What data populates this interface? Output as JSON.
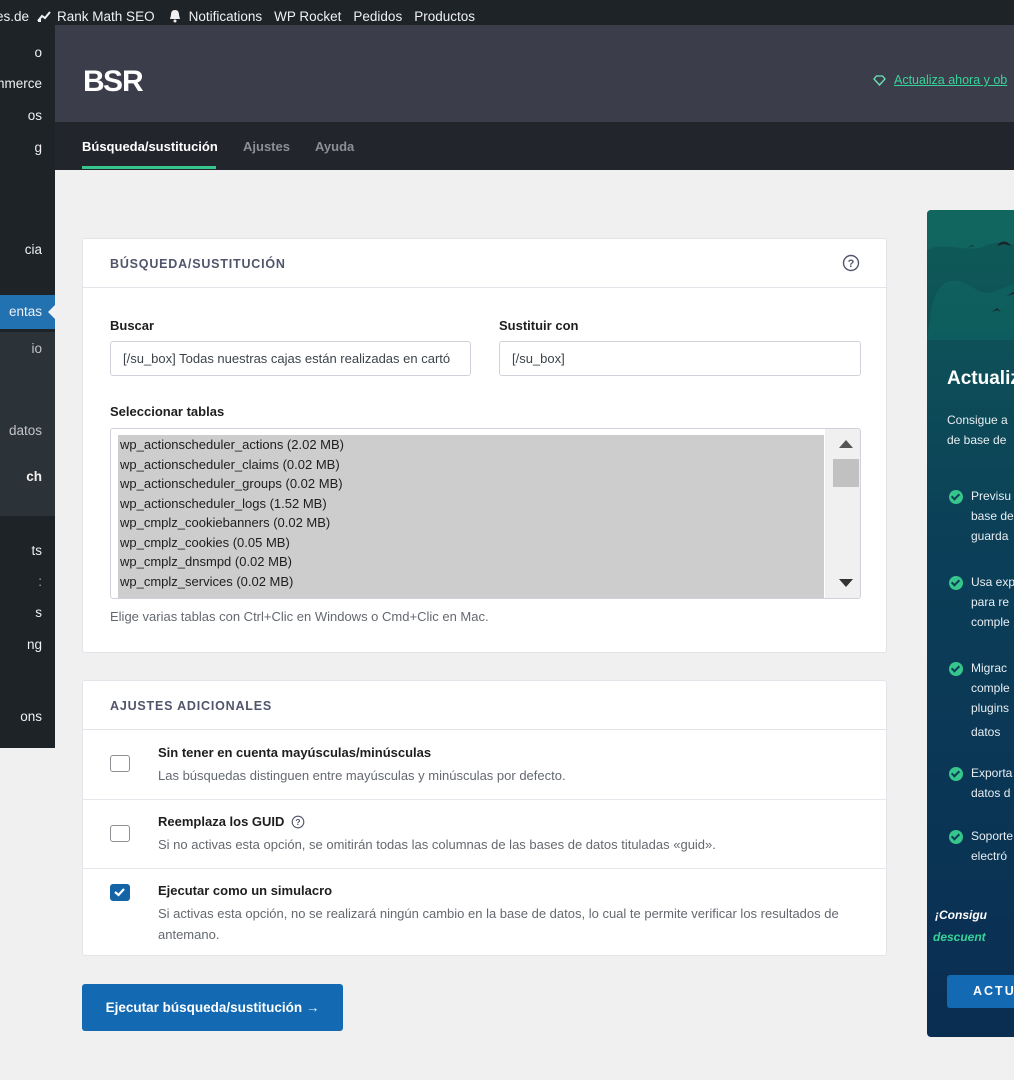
{
  "admin_bar": {
    "site_fragment": "es.de",
    "rank_math": "Rank Math SEO",
    "notifications": "Notifications",
    "wp_rocket": "WP Rocket",
    "pedidos": "Pedidos",
    "productos": "Productos"
  },
  "sidebar": {
    "items": [
      "o",
      "mmerce",
      "os",
      "g",
      "cia",
      "entas",
      "io",
      "datos",
      "ch",
      "ts",
      ":",
      "s",
      "ng",
      "ons"
    ]
  },
  "header": {
    "logo": "BSR",
    "upgrade_link": "Actualiza ahora y ob"
  },
  "tabs": [
    {
      "label": "Búsqueda/sustitución",
      "active": true
    },
    {
      "label": "Ajustes",
      "active": false
    },
    {
      "label": "Ayuda",
      "active": false
    }
  ],
  "search_card": {
    "title": "BÚSQUEDA/SUSTITUCIÓN",
    "search_label": "Buscar",
    "search_value": "[/su_box] Todas nuestras cajas están realizadas en cartó",
    "replace_label": "Sustituir con",
    "replace_value": "[/su_box]",
    "tables_label": "Seleccionar tablas",
    "tables": [
      "wp_actionscheduler_actions (2.02 MB)",
      "wp_actionscheduler_claims (0.02 MB)",
      "wp_actionscheduler_groups (0.02 MB)",
      "wp_actionscheduler_logs (1.52 MB)",
      "wp_cmplz_cookiebanners (0.02 MB)",
      "wp_cmplz_cookies (0.05 MB)",
      "wp_cmplz_dnsmpd (0.02 MB)",
      "wp_cmplz_services (0.02 MB)"
    ],
    "tables_hint": "Elige varias tablas con Ctrl+Clic en Windows o Cmd+Clic en Mac."
  },
  "extra_card": {
    "title": "AJUSTES ADICIONALES",
    "options": [
      {
        "title": "Sin tener en cuenta mayúsculas/minúsculas",
        "desc": "Las búsquedas distinguen entre mayúsculas y minúsculas por defecto.",
        "checked": false
      },
      {
        "title": "Reemplaza los GUID",
        "desc": "Si no activas esta opción, se omitirán todas las columnas de las bases de datos tituladas «guid».",
        "checked": false
      },
      {
        "title": "Ejecutar como un simulacro",
        "desc": "Si activas esta opción, no se realizará ningún cambio en la base de datos, lo cual te permite verificar los resultados de antemano.",
        "checked": true
      }
    ]
  },
  "run_button": "Ejecutar búsqueda/sustitución →",
  "promo": {
    "heading": "Actualiz",
    "intro": [
      "Consigue a",
      "de base de"
    ],
    "features": [
      [
        "Previsu",
        "base de",
        "guarda"
      ],
      [
        "Usa exp",
        "para re",
        "comple"
      ],
      [
        "Migrac",
        "comple",
        "plugins",
        "datos"
      ],
      [
        "Exporta",
        "datos d"
      ],
      [
        "Soporte",
        "electró"
      ]
    ],
    "emphasis_1": "¡Consigu",
    "emphasis_2": "descuent",
    "button": "ACTU"
  },
  "colors": {
    "accent_green": "#36c58a",
    "primary_blue": "#136ab3",
    "header_bg": "#3b3e4a",
    "tabs_bg": "#23252d"
  }
}
